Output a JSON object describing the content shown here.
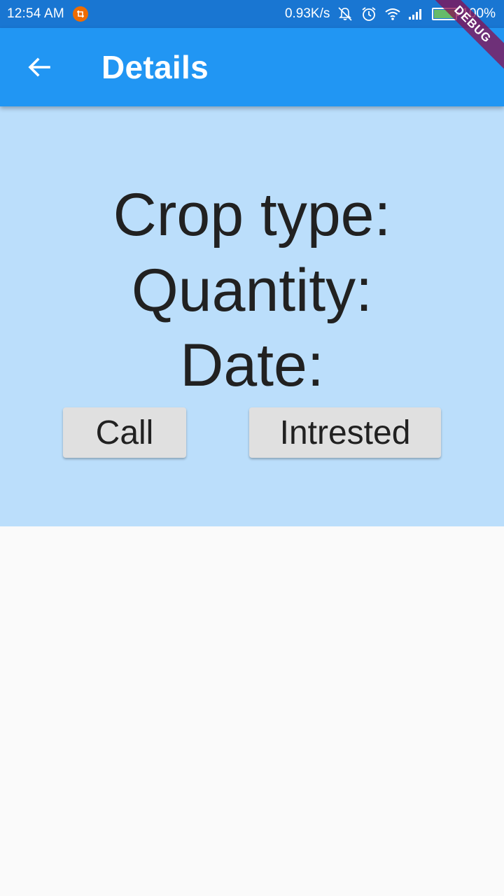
{
  "status_bar": {
    "time": "12:54 AM",
    "network_speed": "0.93K/s",
    "battery_percent": "100%",
    "battery_level": 1.0,
    "icons": [
      "notification-crop-icon",
      "mute-vibrate-icon",
      "alarm-icon",
      "wifi-icon",
      "signal-icon",
      "battery-icon"
    ]
  },
  "app_bar": {
    "title": "Details",
    "back_icon": "arrow-back-icon",
    "color": "#2196f3"
  },
  "debug_banner": "DEBUG",
  "details": {
    "crop_type_label": "Crop type:",
    "quantity_label": "Quantity:",
    "date_label": "Date:",
    "panel_color": "#bbdefb"
  },
  "actions": {
    "call_label": "Call",
    "interested_label": "Intrested"
  }
}
